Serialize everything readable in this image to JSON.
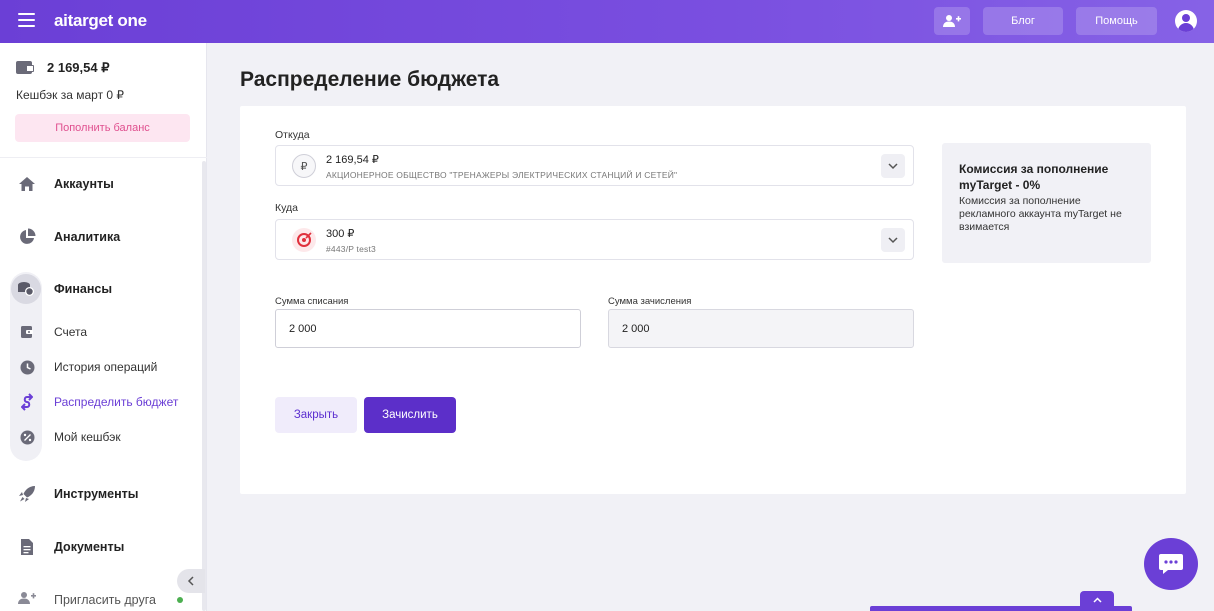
{
  "header": {
    "logo": "aitarget one",
    "add_user_icon": "user-plus-icon",
    "blog_label": "Блог",
    "help_label": "Помощь"
  },
  "sidebar": {
    "balance": "2 169,54 ₽",
    "cashback": "Кешбэк за март 0 ₽",
    "topup_label": "Пополнить баланс",
    "items": [
      {
        "label": "Аккаунты",
        "icon": "home-icon"
      },
      {
        "label": "Аналитика",
        "icon": "pie-chart-icon"
      },
      {
        "label": "Финансы",
        "icon": "coins-icon"
      },
      {
        "label": "Инструменты",
        "icon": "rocket-icon"
      },
      {
        "label": "Документы",
        "icon": "document-icon"
      }
    ],
    "finance_sub": [
      {
        "label": "Счета",
        "icon": "invoice-icon"
      },
      {
        "label": "История операций",
        "icon": "clock-icon"
      },
      {
        "label": "Распределить бюджет",
        "icon": "distribute-icon",
        "active": true
      },
      {
        "label": "Мой кешбэк",
        "icon": "percent-icon"
      }
    ],
    "invite_label": "Пригласить друга"
  },
  "main": {
    "title": "Распределение бюджета",
    "from": {
      "label": "Откуда",
      "amount": "2 169,54 ₽",
      "name": "АКЦИОНЕРНОЕ ОБЩЕСТВО \"ТРЕНАЖЕРЫ ЭЛЕКТРИЧЕСКИХ СТАНЦИЙ И СЕТЕЙ\"",
      "icon_text": "₽"
    },
    "to": {
      "label": "Куда",
      "amount": "300 ₽",
      "name": "#443/P test3"
    },
    "debit": {
      "label": "Сумма списания",
      "value": "2 000"
    },
    "credit": {
      "label": "Сумма зачисления",
      "value": "2 000"
    },
    "close_label": "Закрыть",
    "submit_label": "Зачислить"
  },
  "info": {
    "title": "Комиссия за пополнение myTarget - 0%",
    "description": "Комиссия за пополнение рекламного аккаунта myTarget не взимается"
  },
  "colors": {
    "accent": "#6b3fd6",
    "topup_bg": "#fde6f1",
    "topup_text": "#e0508f"
  }
}
